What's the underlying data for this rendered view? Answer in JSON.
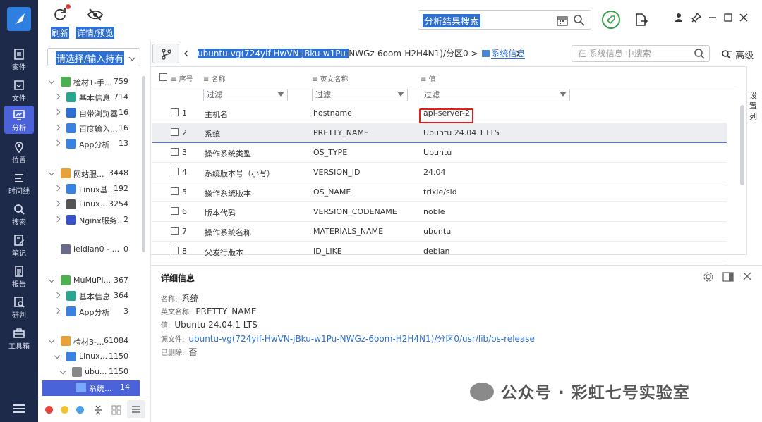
{
  "rail": [
    {
      "label": "案件",
      "icon": "case-icon"
    },
    {
      "label": "文件",
      "icon": "file-icon"
    },
    {
      "label": "分析",
      "icon": "analysis-icon"
    },
    {
      "label": "位置",
      "icon": "location-icon"
    },
    {
      "label": "时间线",
      "icon": "timeline-icon"
    },
    {
      "label": "搜索",
      "icon": "search-icon"
    },
    {
      "label": "笔记",
      "icon": "note-icon"
    },
    {
      "label": "报告",
      "icon": "report-icon"
    },
    {
      "label": "研判",
      "icon": "judge-icon"
    },
    {
      "label": "工具箱",
      "icon": "toolbox-icon"
    }
  ],
  "toolbar": {
    "refresh_label": "刷新",
    "details_label": "详情/预览",
    "search_value": "分析结果搜索"
  },
  "tree": {
    "combo_value": "请选择/输入持有",
    "items": [
      {
        "name": "检材1-手...",
        "count": "759"
      },
      {
        "name": "基本信息",
        "count": "714"
      },
      {
        "name": "自带浏览器",
        "count": "16"
      },
      {
        "name": "百度输入...",
        "count": "16"
      },
      {
        "name": "App分析",
        "count": "13"
      },
      {
        "name": "网站服...",
        "count": "3448"
      },
      {
        "name": "Linux基...",
        "count": "192"
      },
      {
        "name": "Linux...",
        "count": "3254"
      },
      {
        "name": "Nginx服务...",
        "count": "2"
      },
      {
        "name": "leidian0 - ...",
        "count": "0"
      },
      {
        "name": "MuMuPl...",
        "count": "367"
      },
      {
        "name": "基本信息",
        "count": "364"
      },
      {
        "name": "App分析",
        "count": "3"
      },
      {
        "name": "检材3-...",
        "count": "61084"
      },
      {
        "name": "Linux...",
        "count": "1150"
      },
      {
        "name": "ubu...",
        "count": "1150"
      },
      {
        "name": "系统...",
        "count": "14"
      }
    ]
  },
  "crumb": {
    "selected": "ubuntu-vg(724yif-HwVN-jBku-w1Pu-",
    "rest": "NWGz-6oom-H2H4N1)/分区0 >",
    "current": "系统信息"
  },
  "tab_search": {
    "placeholder": "在 系统信息 中搜索"
  },
  "advanced_label": "高级",
  "grid": {
    "headers": {
      "index": "序号",
      "name": "名称",
      "en_name": "英文名称",
      "value": "值"
    },
    "filter_placeholder": "过滤",
    "rows": [
      {
        "idx": "1",
        "name": "主机名",
        "en": "hostname",
        "value": "api-server-2"
      },
      {
        "idx": "2",
        "name": "系统",
        "en": "PRETTY_NAME",
        "value": "Ubuntu 24.04.1 LTS"
      },
      {
        "idx": "3",
        "name": "操作系统类型",
        "en": "OS_TYPE",
        "value": "Ubuntu"
      },
      {
        "idx": "4",
        "name": "系统版本号（小写）",
        "en": "VERSION_ID",
        "value": "24.04"
      },
      {
        "idx": "5",
        "name": "操作系统版本",
        "en": "OS_NAME",
        "value": "trixie/sid"
      },
      {
        "idx": "6",
        "name": "版本代码",
        "en": "VERSION_CODENAME",
        "value": "noble"
      },
      {
        "idx": "7",
        "name": "操作系统名称",
        "en": "MATERIALS_NAME",
        "value": "ubuntu"
      },
      {
        "idx": "8",
        "name": "父发行版本",
        "en": "ID_LIKE",
        "value": "debian"
      }
    ]
  },
  "side_tab": "设置列",
  "detail": {
    "title": "详细信息",
    "name_key": "名称:",
    "name_val": "系统",
    "en_key": "英文名称:",
    "en_val": "PRETTY_NAME",
    "value_key": "值:",
    "value_val": "Ubuntu 24.04.1 LTS",
    "src_key": "源文件:",
    "src_val": "ubuntu-vg(724yif-HwVN-jBku-w1Pu-NWGz-6oom-H2H4N1)/分区0/usr/lib/os-release",
    "del_key": "已删除:",
    "del_val": "否"
  },
  "watermark": "公众号 · 彩虹七号实验室",
  "colors": {
    "rail_bg": "#1e2a4a",
    "accent": "#4a63d8",
    "select": "#2d6fd2",
    "alert": "#e02020"
  }
}
